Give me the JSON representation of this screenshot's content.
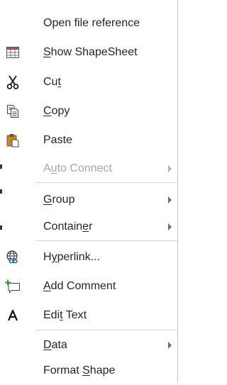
{
  "menu": {
    "items": [
      {
        "id": "open-file-reference",
        "label": "Open file reference",
        "underline": "",
        "icon": "none",
        "submenu": false,
        "enabled": true
      },
      {
        "id": "show-shapesheet",
        "label": "Show ShapeSheet",
        "underline": "S",
        "icon": "shapesheet-icon",
        "submenu": false,
        "enabled": true
      },
      {
        "id": "cut",
        "label": "Cut",
        "underline": "t",
        "icon": "scissors-icon",
        "submenu": false,
        "enabled": true
      },
      {
        "id": "copy",
        "label": "Copy",
        "underline": "C",
        "icon": "copy-icon",
        "submenu": false,
        "enabled": true
      },
      {
        "id": "paste",
        "label": "Paste",
        "underline": "",
        "icon": "paste-icon",
        "submenu": false,
        "enabled": true
      },
      {
        "id": "auto-connect",
        "label": "Auto Connect",
        "underline": "u",
        "icon": "none",
        "submenu": true,
        "enabled": false
      },
      {
        "id": "group",
        "label": "Group",
        "underline": "G",
        "icon": "none",
        "submenu": true,
        "enabled": true
      },
      {
        "id": "container",
        "label": "Container",
        "underline": "e",
        "icon": "none",
        "submenu": true,
        "enabled": true
      },
      {
        "id": "hyperlink",
        "label": "Hyperlink...",
        "underline": "y",
        "icon": "hyperlink-globe-icon",
        "submenu": false,
        "enabled": true
      },
      {
        "id": "add-comment",
        "label": "Add Comment",
        "underline": "A",
        "icon": "add-comment-icon",
        "submenu": false,
        "enabled": true
      },
      {
        "id": "edit-text",
        "label": "Edit Text",
        "underline": "t",
        "icon": "text-a-icon",
        "submenu": false,
        "enabled": true
      },
      {
        "id": "data",
        "label": "Data",
        "underline": "D",
        "icon": "none",
        "submenu": true,
        "enabled": true
      },
      {
        "id": "format-shape",
        "label": "Format Shape",
        "underline": "S",
        "icon": "none",
        "submenu": false,
        "enabled": true
      }
    ]
  },
  "colors": {
    "text": "#262626",
    "disabled_text": "#a6a6a6",
    "separator": "#d8d8d8",
    "paste_clipboard": "#c8862a",
    "comment_plus": "#3a9a3a"
  }
}
